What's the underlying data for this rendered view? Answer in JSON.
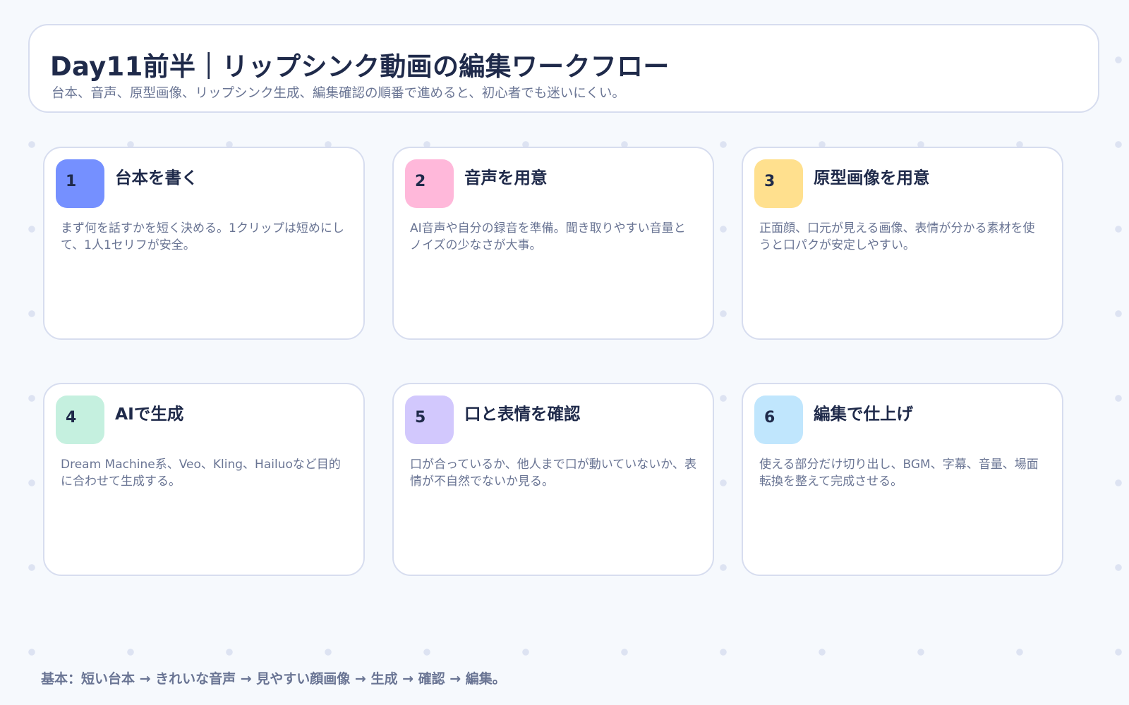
{
  "header": {
    "title": "Day11前半｜リップシンク動画の編集ワークフロー",
    "subtitle": "台本、音声、原型画像、リップシンク生成、編集確認の順番で進めると、初心者でも迷いにくい。"
  },
  "steps": [
    {
      "number": "1",
      "title": "台本を書く",
      "description": "まず何を話すかを短く決める。1クリップは短めにして、1人1セリフが安全。",
      "color": "#7590ff"
    },
    {
      "number": "2",
      "title": "音声を用意",
      "description": "AI音声や自分の録音を準備。聞き取りやすい音量とノイズの少なさが大事。",
      "color": "#ffb8da"
    },
    {
      "number": "3",
      "title": "原型画像を用意",
      "description": "正面顔、口元が見える画像、表情が分かる素材を使うと口パクが安定しやすい。",
      "color": "#ffe08e"
    },
    {
      "number": "4",
      "title": "AIで生成",
      "description": "Dream Machine系、Veo、Kling、Hailuoなど目的に合わせて生成する。",
      "color": "#c5f0df"
    },
    {
      "number": "5",
      "title": "口と表情を確認",
      "description": "口が合っているか、他人まで口が動いていないか、表情が不自然でないか見る。",
      "color": "#d2c8fd"
    },
    {
      "number": "6",
      "title": "編集で仕上げ",
      "description": "使える部分だけ切り出し、BGM、字幕、音量、場面転換を整えて完成させる。",
      "color": "#c0e6fd"
    }
  ],
  "footer": {
    "note": "基本：短い台本 → きれいな音声 → 見やすい顔画像 → 生成 → 確認 → 編集。"
  }
}
